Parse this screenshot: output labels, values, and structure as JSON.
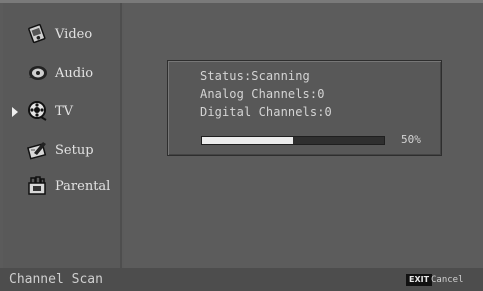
{
  "menu": {
    "items": [
      {
        "label": "Video",
        "icon": "video-icon"
      },
      {
        "label": "Audio",
        "icon": "audio-icon"
      },
      {
        "label": "TV",
        "icon": "tv-icon",
        "selected": true
      },
      {
        "label": "Setup",
        "icon": "setup-icon"
      },
      {
        "label": "Parental",
        "icon": "parental-icon"
      }
    ]
  },
  "scan": {
    "status": "Status:Scanning",
    "analog": "Analog Channels:0",
    "digital": "Digital Channels:0",
    "progress_label": "50%",
    "progress_fraction": 0.5
  },
  "footer": {
    "title": "Channel Scan",
    "exit_key": "EXIT",
    "exit_label": "Cancel"
  },
  "colors": {
    "background": "#5b5b5b",
    "progress_fill": "#ececec",
    "progress_track": "#2f2f2f",
    "footer": "#4d4d4d"
  }
}
